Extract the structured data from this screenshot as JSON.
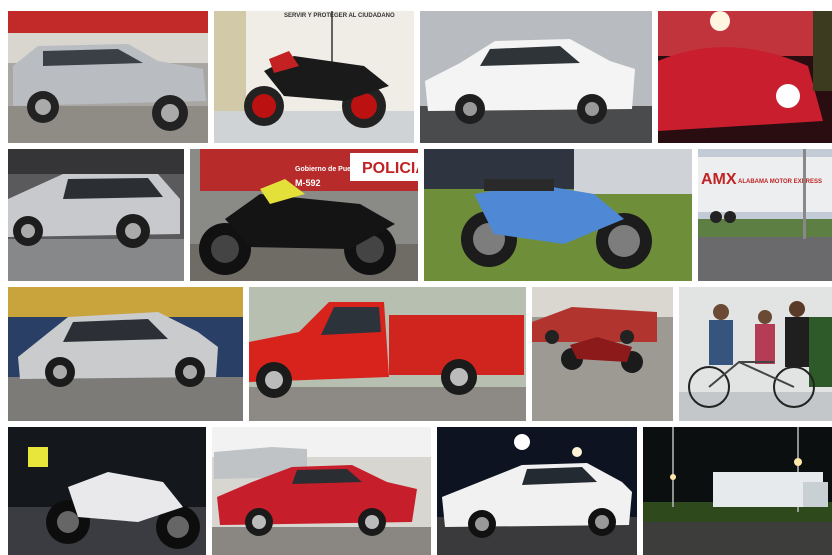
{
  "collage": {
    "tiles": [
      {
        "id": "t1",
        "subject": "silver-suv"
      },
      {
        "id": "t2",
        "subject": "red-black-motorcycle",
        "wall_text": "SERVIR Y PROTEGER AL CIUDADANO"
      },
      {
        "id": "t3",
        "subject": "white-sedan"
      },
      {
        "id": "t4",
        "subject": "red-classic-beetle-at-night"
      },
      {
        "id": "t5",
        "subject": "silver-crossover"
      },
      {
        "id": "t6",
        "subject": "black-yellow-motorcycle",
        "police_text": "POLICIA",
        "unit_text": "M-592",
        "gov_text": "Gobierno de Puebla"
      },
      {
        "id": "t7",
        "subject": "blue-motorcycle-on-grass"
      },
      {
        "id": "t8",
        "subject": "amx-trailer",
        "trailer_brand": "AMX",
        "trailer_caption": "ALABAMA MOTOR EXPRESS"
      },
      {
        "id": "t9",
        "subject": "silver-hatchback"
      },
      {
        "id": "t10",
        "subject": "red-pickup-truck"
      },
      {
        "id": "t11",
        "subject": "red-motorcycle-and-pickup"
      },
      {
        "id": "t12",
        "subject": "people-with-bicycle"
      },
      {
        "id": "t13",
        "subject": "white-motorcycle-at-night"
      },
      {
        "id": "t14",
        "subject": "red-coupe"
      },
      {
        "id": "t15",
        "subject": "white-sedan-at-night"
      },
      {
        "id": "t16",
        "subject": "truck-on-highway-at-night"
      }
    ]
  }
}
